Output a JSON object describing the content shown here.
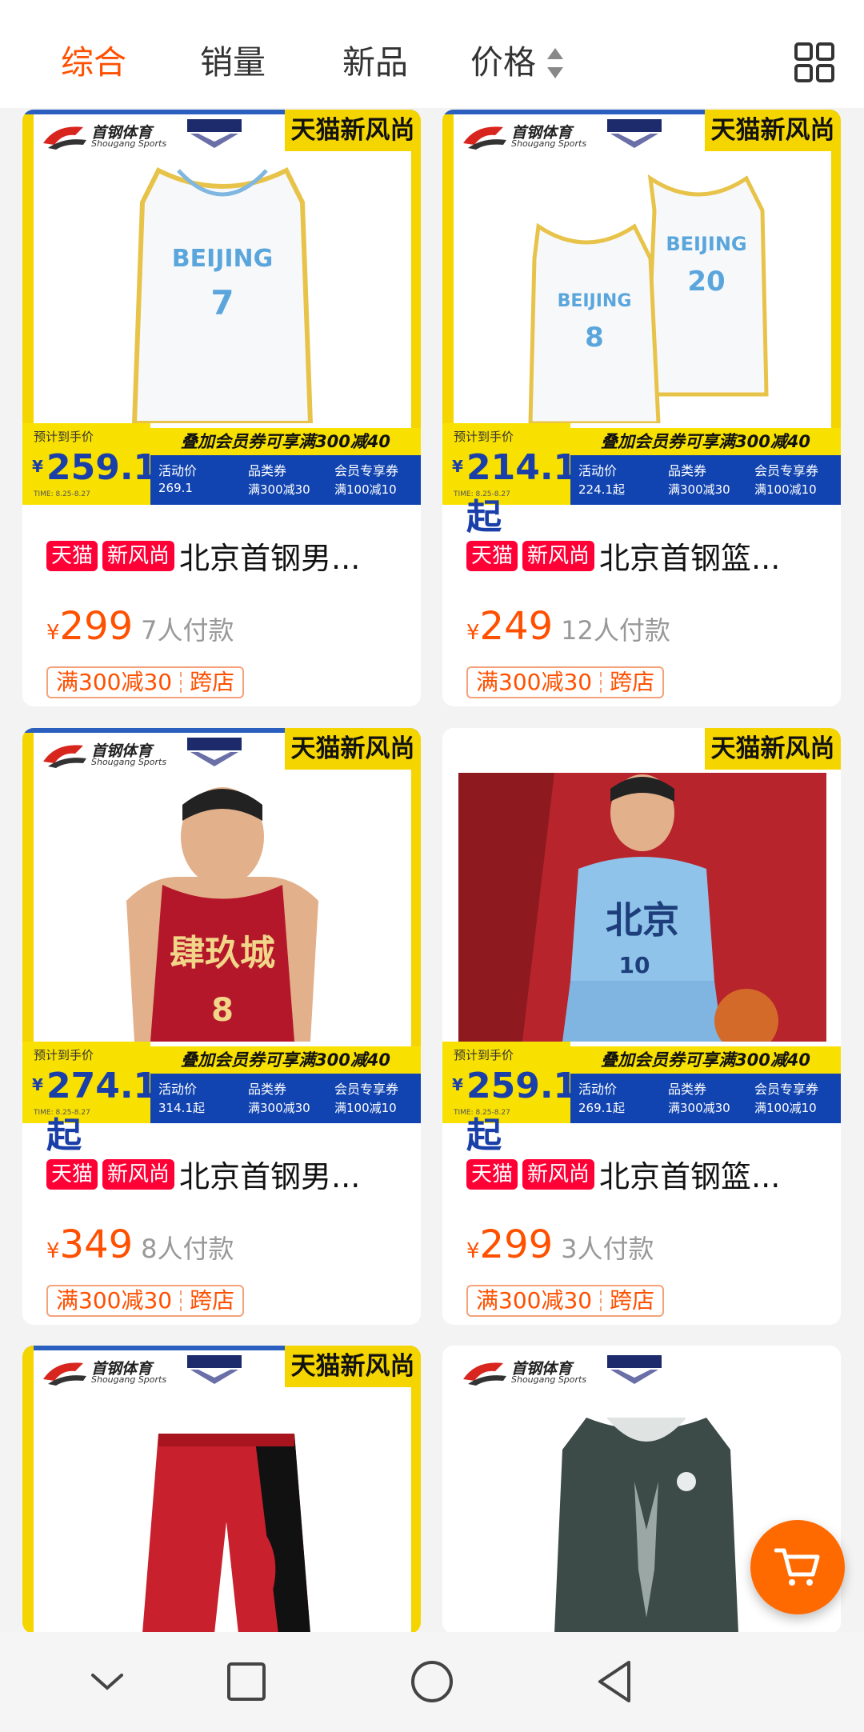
{
  "sort_tabs": [
    {
      "label": "综合",
      "active": true
    },
    {
      "label": "销量",
      "active": false
    },
    {
      "label": "新品",
      "active": false
    },
    {
      "label": "价格",
      "active": false
    }
  ],
  "colors": {
    "accent": "#ff5000",
    "tmall_red": "#ff0036",
    "banner_yellow": "#f8e100",
    "banner_blue": "#1144b0"
  },
  "icons": {
    "layout": "grid-layout-icon",
    "sort": "sort-arrows-icon",
    "cart": "cart-icon"
  },
  "banner": {
    "brand_cn": "首钢体育",
    "brand_en": "Shougang Sports",
    "tmall_new": "天猫新风尚",
    "est_label": "预计到手价",
    "promo": "叠加会员券可享满300减40",
    "col_activity": "活动价",
    "col_coupon": "品类券",
    "col_coupon_val": "满300减30",
    "col_member": "会员专享券",
    "col_member_val": "满100减10",
    "time": "TIME: 8.25-8.27"
  },
  "products": [
    {
      "est_price": "259.1",
      "activity_price": "269.1",
      "badge1": "天猫",
      "badge2": "新风尚",
      "title": "北京首钢男...",
      "price": "299",
      "sold": "7人付款",
      "tag1": "满300减30",
      "tag2": "跨店"
    },
    {
      "est_price": "214.1起",
      "activity_price": "224.1起",
      "badge1": "天猫",
      "badge2": "新风尚",
      "title": "北京首钢篮...",
      "price": "249",
      "sold": "12人付款",
      "tag1": "满300减30",
      "tag2": "跨店"
    },
    {
      "est_price": "274.1起",
      "activity_price": "314.1起",
      "badge1": "天猫",
      "badge2": "新风尚",
      "title": "北京首钢男...",
      "price": "349",
      "sold": "8人付款",
      "tag1": "满300减30",
      "tag2": "跨店"
    },
    {
      "est_price": "259.1起",
      "activity_price": "269.1起",
      "badge1": "天猫",
      "badge2": "新风尚",
      "title": "北京首钢篮...",
      "price": "299",
      "sold": "3人付款",
      "tag1": "满300减30",
      "tag2": "跨店"
    }
  ],
  "partial_cards": [
    {
      "tmall_new": "天猫新风尚"
    },
    {
      "tmall_new": ""
    }
  ],
  "jersey_text": {
    "p1": "BEIJING",
    "p1_num": "7",
    "p2_num_a": "8",
    "p2_num_b": "20",
    "p3": "肆玖城",
    "p3_num": "8",
    "p4": "北京",
    "p4_num": "10"
  },
  "navbar": {
    "back": "back-icon",
    "home": "home-icon",
    "recents": "recents-icon",
    "down": "chevron-down-icon"
  }
}
